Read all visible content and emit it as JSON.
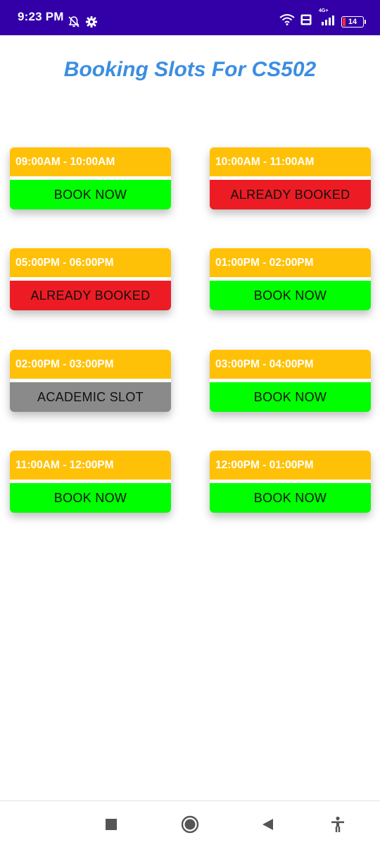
{
  "status_bar": {
    "time": "9:23 PM",
    "battery": "14",
    "network_type": "4G+",
    "icons": [
      "notifications-off-icon",
      "settings-gear-icon",
      "wifi-icon",
      "volte-icon",
      "signal-icon",
      "battery-icon"
    ]
  },
  "page": {
    "title": "Booking Slots For CS502"
  },
  "colors": {
    "status_bar": "#3300a8",
    "title": "#3c8ee0",
    "slot_header": "#ffc107",
    "book_now": "#00ff00",
    "already_booked": "#ed1c24",
    "academic_slot": "#8a8a8a"
  },
  "slots": [
    {
      "time": "09:00AM - 10:00AM",
      "action": "BOOK NOW",
      "status": "available"
    },
    {
      "time": "10:00AM - 11:00AM",
      "action": "ALREADY BOOKED",
      "status": "booked"
    },
    {
      "time": "05:00PM - 06:00PM",
      "action": "ALREADY BOOKED",
      "status": "booked"
    },
    {
      "time": "01:00PM - 02:00PM",
      "action": "BOOK NOW",
      "status": "available"
    },
    {
      "time": "02:00PM - 03:00PM",
      "action": "ACADEMIC SLOT",
      "status": "academic"
    },
    {
      "time": "03:00PM - 04:00PM",
      "action": "BOOK NOW",
      "status": "available"
    },
    {
      "time": "11:00AM - 12:00PM",
      "action": "BOOK NOW",
      "status": "available"
    },
    {
      "time": "12:00PM - 01:00PM",
      "action": "BOOK NOW",
      "status": "available"
    }
  ],
  "nav_bar": {
    "buttons": [
      "recents-square-icon",
      "home-circle-icon",
      "back-triangle-icon",
      "accessibility-icon"
    ]
  }
}
